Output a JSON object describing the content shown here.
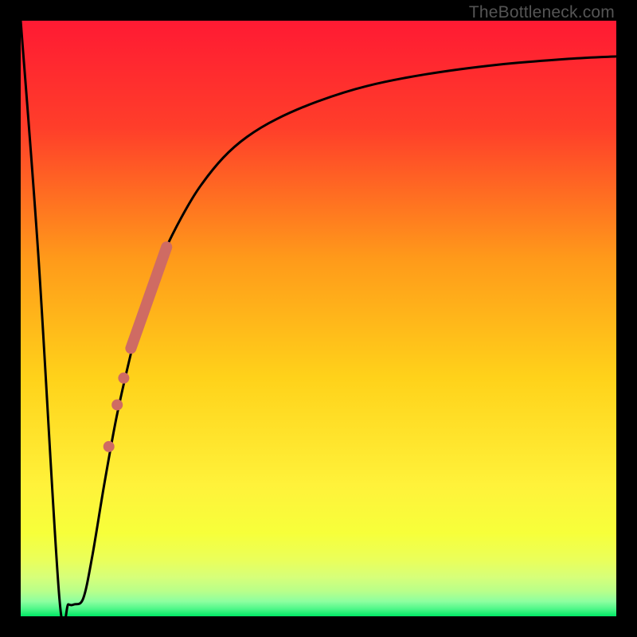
{
  "watermark": "TheBottleneck.com",
  "colors": {
    "top": "#ff1a33",
    "mid_upper": "#ff8a1a",
    "mid": "#ffd21a",
    "mid_lower": "#f7ff3a",
    "bottom_light": "#d0ff7a",
    "bottom": "#00e865",
    "curve": "#000000",
    "marker": "#cf6b63",
    "frame": "#000000"
  },
  "chart_data": {
    "type": "line",
    "title": "",
    "xlabel": "",
    "ylabel": "",
    "xlim": [
      0,
      100
    ],
    "ylim": [
      0,
      100
    ],
    "series": [
      {
        "name": "bottleneck-curve",
        "x": [
          0,
          3,
          6.5,
          8,
          9,
          10.5,
          12,
          14,
          16,
          18,
          20,
          22,
          24,
          27,
          30,
          34,
          38,
          43,
          50,
          58,
          68,
          80,
          92,
          100
        ],
        "y": [
          100,
          60,
          3,
          2,
          2,
          3,
          10,
          22,
          33,
          42,
          50,
          56,
          61,
          67,
          72,
          77,
          80.5,
          83.5,
          86.5,
          89,
          91,
          92.6,
          93.6,
          94
        ]
      }
    ],
    "markers": [
      {
        "name": "thick-segment",
        "type": "line",
        "x": [
          18.5,
          24.5
        ],
        "y": [
          45,
          62
        ],
        "width": 14
      },
      {
        "name": "dot-1",
        "type": "point",
        "x": 17.3,
        "y": 40,
        "r": 7
      },
      {
        "name": "dot-2",
        "type": "point",
        "x": 16.2,
        "y": 35.5,
        "r": 7
      },
      {
        "name": "dot-3",
        "type": "point",
        "x": 14.8,
        "y": 28.5,
        "r": 7
      }
    ]
  }
}
